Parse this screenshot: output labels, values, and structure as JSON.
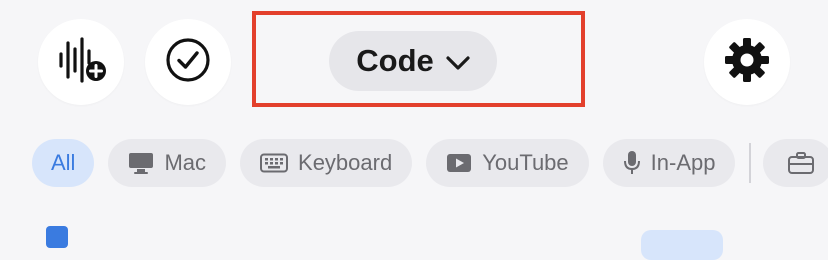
{
  "header": {
    "mode_label": "Code",
    "icons": {
      "record": "waveform-plus-icon",
      "check": "check-circle-icon",
      "mode_toggle": "chevron-down-icon",
      "settings": "gear-icon"
    }
  },
  "filters": {
    "items": [
      {
        "label": "All",
        "icon": null,
        "active": true
      },
      {
        "label": "Mac",
        "icon": "monitor-icon",
        "active": false
      },
      {
        "label": "Keyboard",
        "icon": "keyboard-icon",
        "active": false
      },
      {
        "label": "YouTube",
        "icon": "play-icon",
        "active": false
      },
      {
        "label": "In-App",
        "icon": "microphone-icon",
        "active": false
      },
      {
        "label": "",
        "icon": "briefcase-icon",
        "active": false
      }
    ]
  },
  "colors": {
    "accent": "#3a7be0",
    "highlight_border": "#e3402c",
    "chip_bg": "#e9e9ed",
    "active_chip_bg": "#d7e5fb"
  }
}
